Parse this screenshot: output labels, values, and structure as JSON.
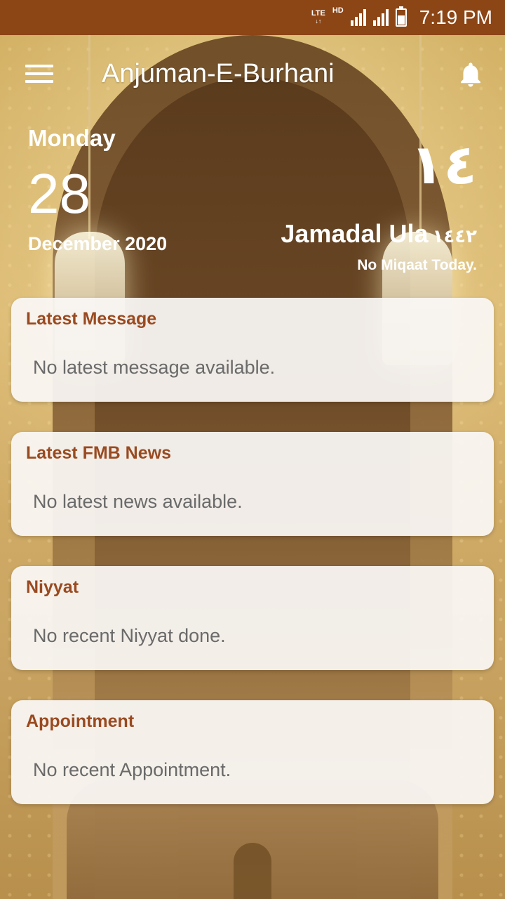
{
  "status_bar": {
    "network": "LTE",
    "hd": "HD",
    "time": "7:19 PM"
  },
  "app_bar": {
    "title": "Anjuman-E-Burhani",
    "menu_icon": "hamburger-menu-icon",
    "notification_icon": "bell-icon"
  },
  "date": {
    "day_name": "Monday",
    "day_number": "28",
    "month_year": "December 2020"
  },
  "hijri": {
    "day": "١٤",
    "month": "Jamadal Ula",
    "year": "١٤٤٢",
    "miqaat": "No Miqaat Today."
  },
  "cards": [
    {
      "title": "Latest Message",
      "body": "No latest message available."
    },
    {
      "title": "Latest FMB News",
      "body": "No latest news available."
    },
    {
      "title": "Niyyat",
      "body": "No recent Niyyat done."
    },
    {
      "title": "Appointment",
      "body": "No recent Appointment."
    }
  ],
  "colors": {
    "status_bar": "#8c4515",
    "card_title": "#9a4a20",
    "card_body": "#6a6a6a"
  }
}
